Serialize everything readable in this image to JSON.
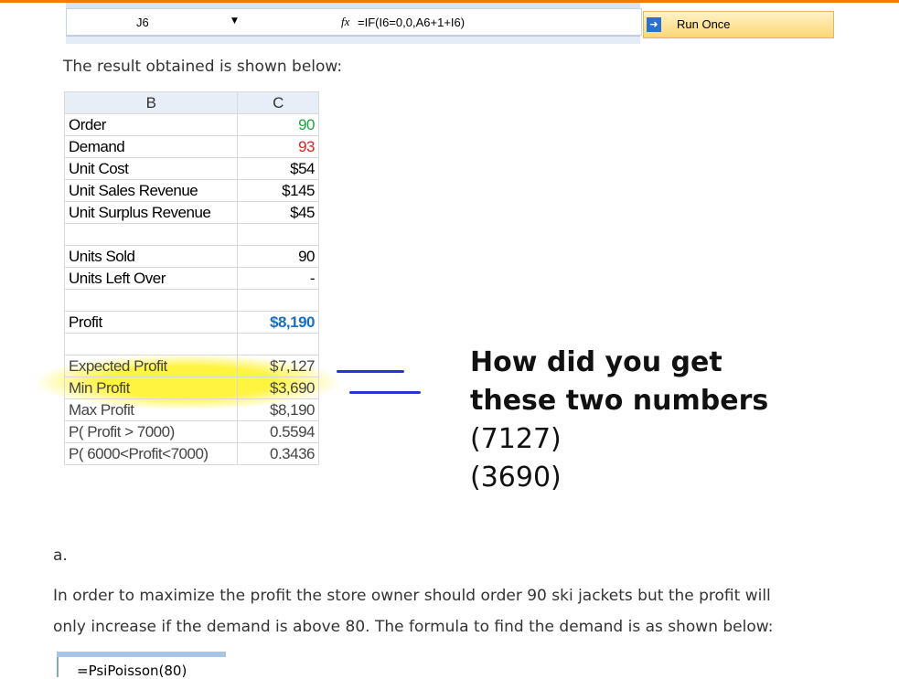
{
  "excel": {
    "cell_ref": "J6",
    "formula": "=IF(I6=0,0,A6+1+I6)",
    "run_once": "Run Once"
  },
  "intro": "The result obtained is shown below:",
  "table": {
    "headers": [
      "B",
      "C"
    ],
    "rows": [
      {
        "label": "Order",
        "value": "90",
        "color": "#22a244"
      },
      {
        "label": "Demand",
        "value": "93",
        "color": "#e02020"
      },
      {
        "label": "Unit Cost",
        "value": "$54"
      },
      {
        "label": "Unit Sales Revenue",
        "value": "$145"
      },
      {
        "label": "Unit Surplus Revenue",
        "value": "$45"
      },
      {
        "label": "",
        "value": ""
      },
      {
        "label": "Units Sold",
        "value": "90"
      },
      {
        "label": "Units Left Over",
        "value": "-"
      },
      {
        "label": "",
        "value": ""
      },
      {
        "label": "Profit",
        "value": "$8,190",
        "color": "#1a6fc0"
      },
      {
        "label": "",
        "value": ""
      },
      {
        "label": "Expected Profit",
        "value": "$7,127"
      },
      {
        "label": "Min Profit",
        "value": "$3,690"
      },
      {
        "label": "Max Profit",
        "value": "$8,190"
      },
      {
        "label": "P( Profit > 7000)",
        "value": "0.5594"
      },
      {
        "label": "P( 6000<Profit<7000)",
        "value": "0.3436"
      }
    ]
  },
  "note": [
    "How did you get",
    "these two numbers",
    "(7127)",
    "(3690)"
  ],
  "item_a": "a.",
  "para1": "In order to maximize the profit the store owner should order 90 ski jackets but the profit will",
  "para2": "only increase if the demand is above 80. The formula to find the demand is as shown below:",
  "formula2": "=PsiPoisson(80)"
}
